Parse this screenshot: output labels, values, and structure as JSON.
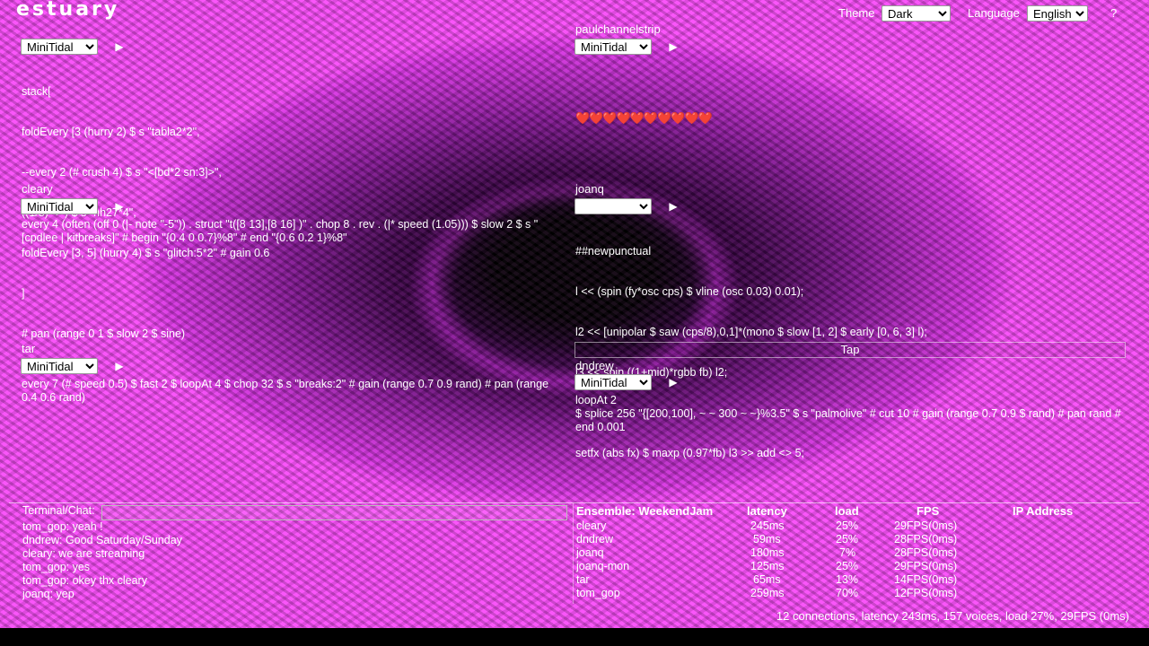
{
  "app": {
    "logo": "estuary"
  },
  "header": {
    "theme_label": "Theme",
    "theme_value": "Dark",
    "language_label": "Language",
    "language_value": "English",
    "help_label": "?"
  },
  "panels": [
    {
      "name": "",
      "language": "MiniTidal",
      "lines": [
        "stack[",
        "foldEvery [3 (hurry 2) $ s \"tabla2*2\",",
        "--every 2 (# crush 4) $ s \"<[bd*2 sn:3]>\",",
        "((1/8) <~) $ s \"hh27*4\",",
        "foldEvery [3, 5] (hurry 4) $ s \"glitch:5*2\" # gain 0.6",
        "]",
        "# pan (range 0 1 $ slow 2 $ sine)"
      ]
    },
    {
      "name": "paulchannelstrip",
      "language": "MiniTidal",
      "hearts": "❤️❤️❤️❤️❤️❤️❤️❤️❤️❤️"
    },
    {
      "name": "cleary",
      "language": "MiniTidal",
      "text": "every 4 (often (off 0 (|- note \"-5\")) . struct \"t([8 13],[8 16] )\" . chop 8 . rev . (|* speed (1.05))) $ slow 2 $ s \"[cpdlee | kitbreaks]\" # begin \"{0.4 0 0.7}%8\" # end \"{0.6 0.2 1}%8\""
    },
    {
      "name": "joanq",
      "language": "",
      "lines": [
        "##newpunctual",
        "l << (spin (fy*osc cps) $ vline (osc 0.03) 0.01);",
        "l2 << [unipolar $ saw (cps/8),0,1]*(mono $ slow [1, 2] $ early [0, 6, 3] l);",
        "l3 << spin ((1+mid)*rgbb fb) l2;",
        "",
        "setfx (abs fx) $ maxp (0.97*fb) l3 >> add <> 5;"
      ]
    },
    {
      "name": "tar",
      "language": "MiniTidal",
      "text": "every 7 (# speed 0.5) $ fast 2 $ loopAt 4 $ chop 32 $ s \"breaks:2\" # gain (range 0.7 0.9 rand) # pan (range 0.4 0.6 rand)"
    },
    {
      "name": "dndrew",
      "language": "MiniTidal",
      "text": "loopAt 2\n$ splice 256 \"{[200,100], ~ ~ 300 ~ ~}%3.5\" $ s \"palmolive\" # cut 10 # gain (range 0.7 0.9 $ rand) # pan rand # end 0.001"
    }
  ],
  "tap_label": "Tap",
  "terminal": {
    "label": "Terminal/Chat:",
    "input_value": "",
    "messages": [
      "tom_gop: yeah !",
      "dndrew: Good Saturday/Sunday",
      "cleary: we are streaming",
      "tom_gop: yes",
      "tom_gop: okey thx cleary",
      "joanq: yep"
    ]
  },
  "ensemble": {
    "headers": [
      "Ensemble: WeekendJam",
      "latency",
      "load",
      "FPS",
      "IP Address"
    ],
    "rows": [
      [
        "cleary",
        "245ms",
        "25%",
        "29FPS(0ms)",
        ""
      ],
      [
        "dndrew",
        "59ms",
        "25%",
        "28FPS(0ms)",
        ""
      ],
      [
        "joanq",
        "180ms",
        "7%",
        "28FPS(0ms)",
        ""
      ],
      [
        "joanq-mon",
        "125ms",
        "25%",
        "29FPS(0ms)",
        ""
      ],
      [
        "tar",
        "65ms",
        "13%",
        "14FPS(0ms)",
        ""
      ],
      [
        "tom_gop",
        "259ms",
        "70%",
        "12FPS(0ms)",
        ""
      ]
    ]
  },
  "status": "12 connections, latency 243ms, 157 voices, load 27%, 29FPS (0ms)",
  "icons": {
    "play": "play-icon"
  }
}
